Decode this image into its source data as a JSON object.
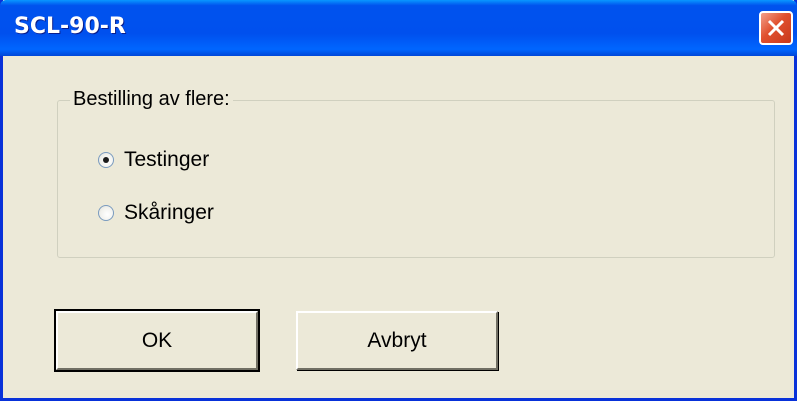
{
  "window": {
    "title": "SCL-90-R",
    "close_icon": "close-icon"
  },
  "group": {
    "legend": "Bestilling av flere:",
    "options": [
      {
        "label": "Testinger",
        "checked": true
      },
      {
        "label": "Skåringer",
        "checked": false
      }
    ]
  },
  "buttons": {
    "ok_label": "OK",
    "cancel_label": "Avbryt"
  },
  "colors": {
    "titlebar": "#0053ee",
    "window_bg": "#ece9d8",
    "close_button": "#e0502e"
  }
}
